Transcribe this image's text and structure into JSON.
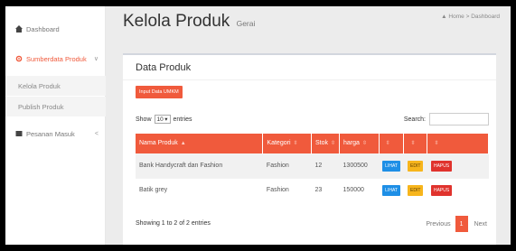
{
  "sidebar": {
    "dashboard": "Dashboard",
    "sumberdata": "Sumberdata Produk",
    "kelola": "Kelola Produk",
    "publish": "Publish Produk",
    "pesanan": "Pesanan Masuk",
    "icons": {
      "dashboard": "dashboard-icon",
      "sumberdata": "gear-icon",
      "pesanan": "book-icon"
    }
  },
  "header": {
    "title": "Kelola Produk",
    "subtitle": "Gerai",
    "breadcrumb_home": "Home",
    "breadcrumb_sep": ">",
    "breadcrumb_current": "Dashboard"
  },
  "box": {
    "title": "Data Produk",
    "input_button": "Input Data UMKM",
    "show_label": "Show",
    "entries_value": "10",
    "entries_label": "entries",
    "search_label": "Search:"
  },
  "table": {
    "columns": [
      "Nama Produk",
      "Kategori",
      "Stok",
      "harga",
      "",
      "",
      ""
    ],
    "rows": [
      {
        "nama": "Bank Handycraft dan Fashion",
        "kategori": "Fashion",
        "stok": "12",
        "harga": "1300500"
      },
      {
        "nama": "Batik grey",
        "kategori": "Fashion",
        "stok": "23",
        "harga": "150000"
      }
    ],
    "actions": {
      "lihat": "LIHAT",
      "edit": "EDIT",
      "hapus": "HAPUS"
    }
  },
  "footer": {
    "info": "Showing 1 to 2 of 2 entries",
    "previous": "Previous",
    "current_page": "1",
    "next": "Next"
  },
  "colors": {
    "accent": "#f05a3c",
    "lihat": "#1e8fe6",
    "edit": "#f7b51c",
    "hapus": "#e0332d"
  }
}
